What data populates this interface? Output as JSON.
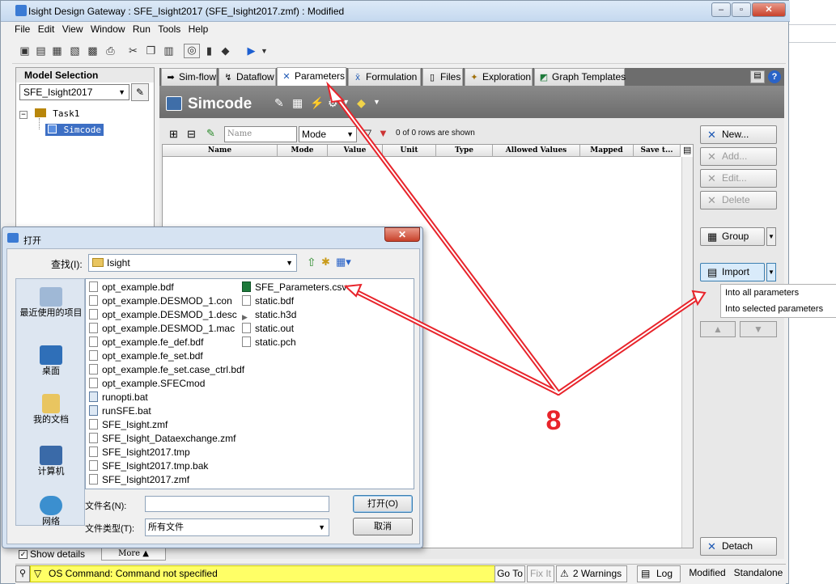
{
  "window": {
    "title": "Isight Design Gateway : SFE_Isight2017 (SFE_Isight2017.zmf)  : Modified"
  },
  "menu": [
    "File",
    "Edit",
    "View",
    "Window",
    "Run",
    "Tools",
    "Help"
  ],
  "model_selection": {
    "header": "Model Selection",
    "value": "SFE_Isight2017",
    "tree": [
      "Task1",
      "Simcode"
    ]
  },
  "tabs": [
    {
      "label": "Sim-flow",
      "icon": "arrow-right-icon"
    },
    {
      "label": "Dataflow",
      "icon": "dataflow-icon"
    },
    {
      "label": "Parameters",
      "icon": "parameters-icon",
      "active": true
    },
    {
      "label": "Formulation",
      "icon": "formulation-icon"
    },
    {
      "label": "Files",
      "icon": "file-icon"
    },
    {
      "label": "Exploration",
      "icon": "exploration-icon"
    },
    {
      "label": "Graph Templates",
      "icon": "graph-icon"
    }
  ],
  "component": {
    "title": "Simcode"
  },
  "params": {
    "filter_placeholder": "Name",
    "mode_select": "Mode",
    "rows_shown": "0 of 0 rows are shown",
    "columns": [
      "Name",
      "Mode",
      "Value",
      "Unit",
      "Type",
      "Allowed Values",
      "Mapped",
      "Save t..."
    ]
  },
  "right_buttons": {
    "new": "New...",
    "add": "Add...",
    "edit": "Edit...",
    "delete": "Delete",
    "group": "Group",
    "import": "Import",
    "detach": "Detach"
  },
  "import_menu": [
    "Into all parameters",
    "Into selected parameters"
  ],
  "status": {
    "message": "OS Command: Command not specified",
    "goto": "Go To",
    "fixit": "Fix It",
    "warnings": "2 Warnings",
    "log": "Log",
    "modified": "Modified",
    "standalone": "Standalone",
    "show_details": "Show details",
    "more": "More"
  },
  "open_dialog": {
    "title": "打开",
    "lookin_label": "查找(I):",
    "lookin_value": "Isight",
    "places": [
      "最近使用的项目",
      "桌面",
      "我的文档",
      "计算机",
      "网络"
    ],
    "files_col1": [
      "opt_example.bdf",
      "opt_example.DESMOD_1.con",
      "opt_example.DESMOD_1.desc",
      "opt_example.DESMOD_1.mac",
      "opt_example.fe_def.bdf",
      "opt_example.fe_set.bdf",
      "opt_example.fe_set.case_ctrl.bdf",
      "opt_example.SFECmod",
      "runopti.bat",
      "runSFE.bat",
      "SFE_Isight.zmf",
      "SFE_Isight_Dataexchange.zmf",
      "SFE_Isight2017.tmp",
      "SFE_Isight2017.tmp.bak",
      "SFE_Isight2017.zmf"
    ],
    "files_col2": [
      "SFE_Parameters.csv",
      "static.bdf",
      "static.h3d",
      "static.out",
      "static.pch"
    ],
    "filename_label": "文件名(N):",
    "filename_value": "",
    "filetype_label": "文件类型(T):",
    "filetype_value": "所有文件",
    "open_button": "打开(O)",
    "cancel_button": "取消"
  },
  "annotation": {
    "label": "8",
    "color": "#e8242b"
  }
}
